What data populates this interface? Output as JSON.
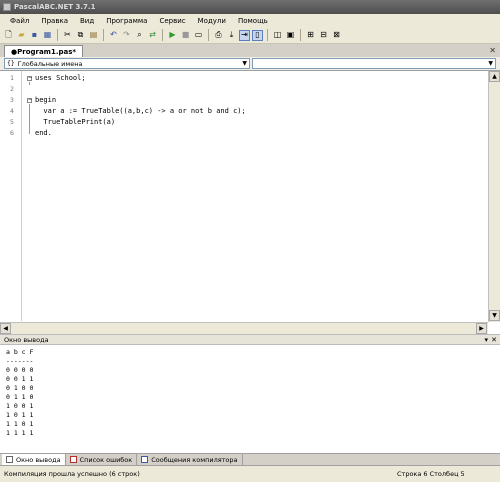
{
  "window": {
    "title": "PascalABC.NET 3.7.1"
  },
  "menu": [
    "Файл",
    "Правка",
    "Вид",
    "Программа",
    "Сервис",
    "Модули",
    "Помощь"
  ],
  "toolbar": {
    "icons": [
      "new-file-icon",
      "open-folder-icon",
      "save-icon",
      "save-all-icon",
      "cut-icon",
      "copy-icon",
      "paste-icon",
      "undo-icon",
      "redo-icon",
      "find-icon",
      "replace-icon",
      "run-icon",
      "stop-icon",
      "debug-icon",
      "format-icon",
      "step-into-icon",
      "step-over-icon",
      "breakpoint-icon",
      "watch-icon",
      "settings-icon",
      "window-1-icon",
      "window-2-icon",
      "window-3-icon"
    ]
  },
  "editor": {
    "tab_label": "●Program1.pas*",
    "scope_combo": "Глобальные имена",
    "member_combo": "",
    "lines": [
      {
        "num": "1",
        "text": "uses School;"
      },
      {
        "num": "2",
        "text": ""
      },
      {
        "num": "3",
        "text": "begin"
      },
      {
        "num": "4",
        "text": "  var a := TrueTable((a,b,c) -> a or not b and c);"
      },
      {
        "num": "5",
        "text": "  TrueTablePrint(a)"
      },
      {
        "num": "6",
        "text": "end."
      }
    ]
  },
  "output": {
    "header": "Окно вывода",
    "lines": [
      "a b c F",
      "-------",
      "0 0 0 0",
      "0 0 1 1",
      "0 1 0 0",
      "0 1 1 0",
      "1 0 0 1",
      "1 0 1 1",
      "1 1 0 1",
      "1 1 1 1"
    ]
  },
  "bottom_tabs": [
    "Окно вывода",
    "Список ошибок",
    "Сообщения компилятора"
  ],
  "status": {
    "message": "Компиляция прошла успешно (6 строк)",
    "position": "Строка  6  Столбец  5"
  }
}
